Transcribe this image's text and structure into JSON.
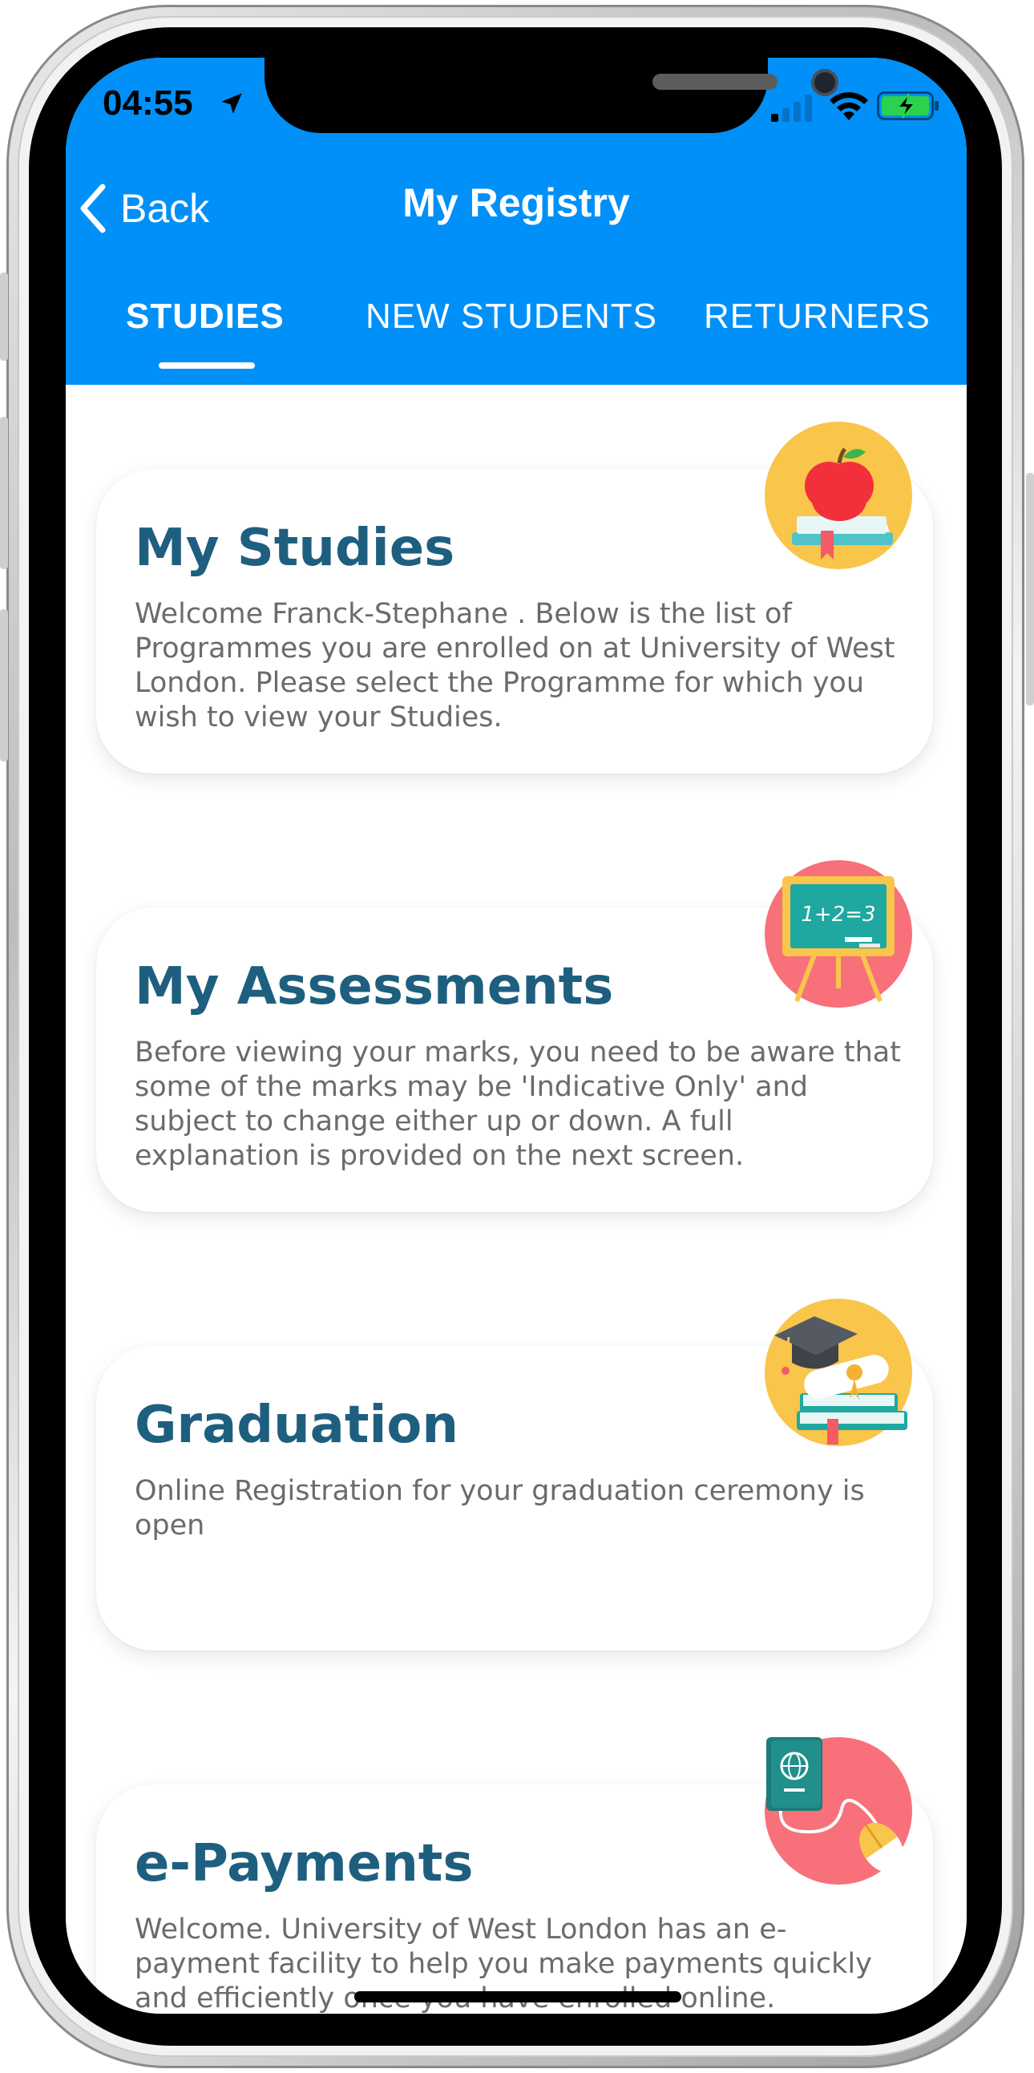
{
  "status_bar": {
    "time": "04:55",
    "location_icon": "location-arrow-icon",
    "signal_icon": "cellular-signal-icon",
    "wifi_icon": "wifi-icon",
    "battery_icon": "battery-charging-icon"
  },
  "nav": {
    "back_label": "Back",
    "back_icon": "chevron-left-icon",
    "title": "My Registry"
  },
  "tabs": [
    {
      "label": "STUDIES",
      "active": true
    },
    {
      "label": "NEW STUDENTS",
      "active": false
    },
    {
      "label": "RETURNERS",
      "active": false
    }
  ],
  "cards": [
    {
      "title": "My Studies",
      "description": "Welcome Franck-Stephane . Below is the list of Programmes you are enrolled on at University of West London. Please select the Programme for which you wish to view your Studies.",
      "icon": "apple-books-icon"
    },
    {
      "title": "My Assessments",
      "description": "Before viewing your marks, you need to be aware that some of the marks may be 'Indicative Only' and subject to change either up or down. A full explanation is provided on the next screen.",
      "icon": "chalkboard-icon",
      "icon_text": "1+2=3"
    },
    {
      "title": "Graduation",
      "description": "Online Registration for your graduation ceremony is open",
      "icon": "graduation-cap-books-icon"
    },
    {
      "title": "e-Payments",
      "description": "Welcome. University of West London has an e-payment facility to help you make payments quickly and efficiently once you have enrolled online.",
      "icon": "passport-mouse-icon"
    }
  ],
  "colors": {
    "header": "#0190f8",
    "card_title": "#1e5f7f",
    "card_text": "#6b6b6b",
    "badge_yellow": "#f9c54a",
    "badge_red": "#f7707a"
  }
}
